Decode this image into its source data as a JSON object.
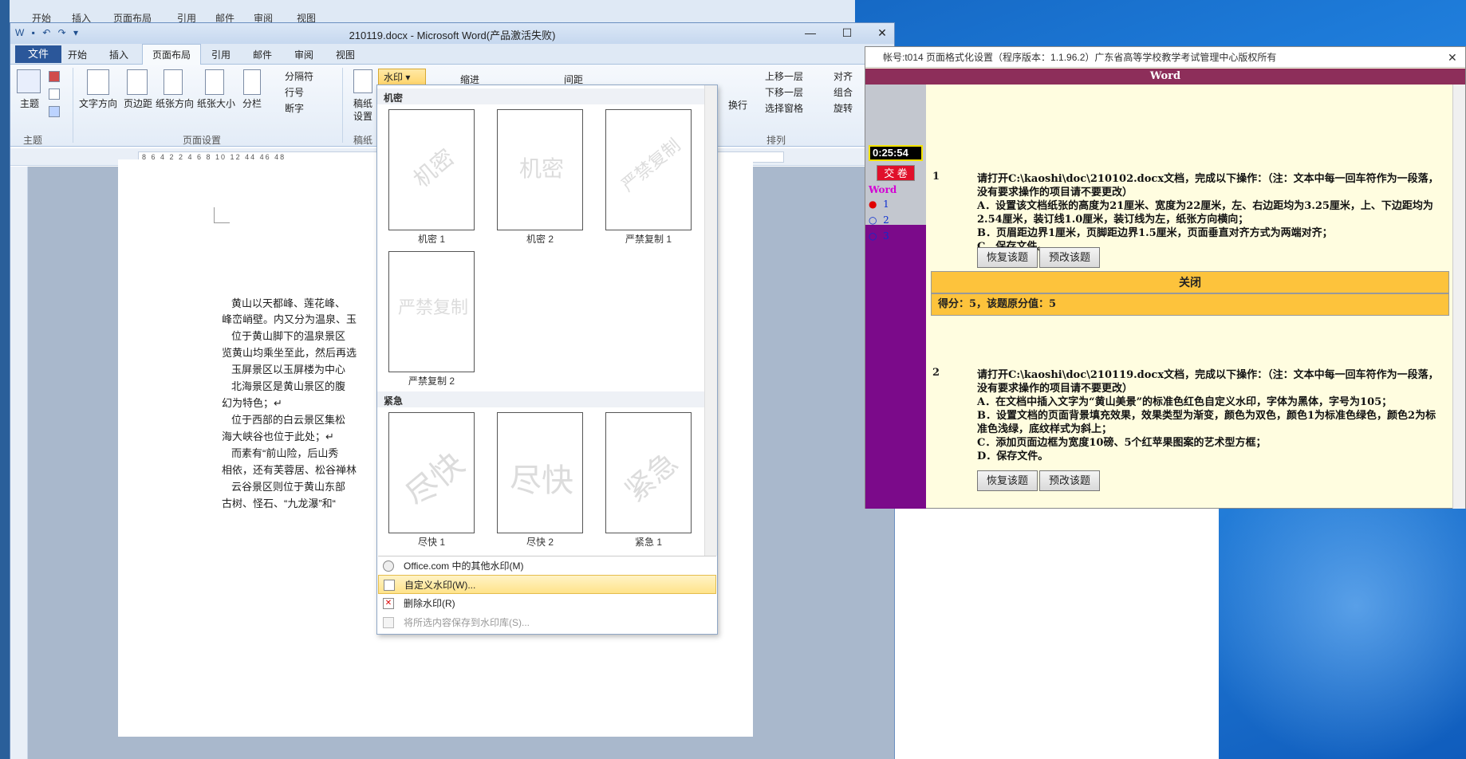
{
  "back_window": {
    "tabs": [
      "开始",
      "插入",
      "页面布局",
      "引用",
      "邮件",
      "审阅",
      "视图"
    ]
  },
  "word": {
    "title": "210119.docx - Microsoft Word(产品激活失败)",
    "tabs": {
      "file": "文件",
      "home": "开始",
      "insert": "插入",
      "layout": "页面布局",
      "references": "引用",
      "mailings": "邮件",
      "review": "审阅",
      "view": "视图"
    },
    "ribbon": {
      "themes": "主题",
      "text_direction": "文字方向",
      "margins": "页边距",
      "orientation": "纸张方向",
      "size": "纸张大小",
      "columns": "分栏",
      "breaks": "分隔符",
      "line_numbers": "行号",
      "hyphenation": "断字",
      "manuscript": "稿纸",
      "manuscript_settings": "设置",
      "watermark": "水印",
      "indent": "缩进",
      "spacing": "间距",
      "bring_forward": "上移一层",
      "send_backward": "下移一层",
      "selection_pane": "选择窗格",
      "align": "对齐",
      "group": "组合",
      "rotate": "旋转",
      "wrap": "换行",
      "group_labels": {
        "themes": "主题",
        "page_setup": "页面设置",
        "manuscript": "稿纸",
        "arrange": "排列"
      }
    },
    "ruler_text": "8 6 4 2 2 4 6 8 10 12 44 46 48",
    "document_lines": [
      "黄山以天都峰、莲花峰、",
      "峰峦峭壁。内又分为温泉、玉",
      "位于黄山脚下的温泉景区",
      "览黄山均乘坐至此，然后再选",
      "玉屏景区以玉屏楼为中心",
      "北海景区是黄山景区的腹",
      "幻为特色；↵",
      "位于西部的白云景区集松",
      "海大峡谷也位于此处；↵",
      "而素有“前山险，后山秀",
      "相依，还有芙蓉居、松谷禅林",
      "云谷景区则位于黄山东部",
      "古树、怪石、“九龙瀑”和“"
    ]
  },
  "watermark_gallery": {
    "section_confidential": "机密",
    "section_urgent": "紧急",
    "items": [
      {
        "text": "机密",
        "label": "机密 1"
      },
      {
        "text": "机密",
        "label": "机密 2"
      },
      {
        "text": "严禁复制",
        "label": "严禁复制 1"
      },
      {
        "text": "严禁复制",
        "label": "严禁复制 2"
      },
      {
        "text": "尽快",
        "label": "尽快 1"
      },
      {
        "text": "尽快",
        "label": "尽快 2"
      },
      {
        "text": "紧急",
        "label": "紧急 1"
      }
    ],
    "menu": {
      "more": "Office.com 中的其他水印(M)",
      "custom": "自定义水印(W)...",
      "remove": "删除水印(R)",
      "save": "将所选内容保存到水印库(S)..."
    }
  },
  "exam": {
    "title": "帐号:t014  页面格式化设置（程序版本：1.1.96.2）广东省高等学校教学考试管理中心版权所有",
    "banner": "Word",
    "timer": "0:25:54",
    "submit": "交 卷",
    "nav_word": "Word",
    "nav_items": [
      "1",
      "2",
      "3"
    ],
    "questions": [
      {
        "number": "1",
        "lines": [
          "请打开C:\\kaoshi\\doc\\210102.docx文档，完成以下操作：（注：文本中每一回车符作为一段落，没有要求操作的项目请不要更改）",
          "A．设置该文档纸张的高度为21厘米、宽度为22厘米，左、右边距均为3.25厘米，上、下边距均为2.54厘米，装订线1.0厘米，装订线为左，纸张方向横向；",
          "B．页眉距边界1厘米，页脚距边界1.5厘米，页面垂直对齐方式为两端对齐；",
          "C．保存文件。"
        ],
        "restore": "恢复该题",
        "review": "预改该题"
      },
      {
        "number": "2",
        "lines": [
          "请打开C:\\kaoshi\\doc\\210119.docx文档，完成以下操作：（注：文本中每一回车符作为一段落，没有要求操作的项目请不要更改）",
          "A．在文档中插入文字为“黄山美景”的标准色红色自定义水印，字体为黑体，字号为105；",
          "B．设置文档的页面背景填充效果，效果类型为渐变，颜色为双色，颜色1为标准色绿色，颜色2为标准色浅绿，底纹样式为斜上；",
          "C．添加页面边框为宽度10磅、5个红苹果图案的艺术型方框；",
          "D．保存文件。"
        ],
        "restore": "恢复该题",
        "review": "预改该题"
      }
    ],
    "close": "关闭",
    "score": "得分：5，该题原分值：5"
  }
}
